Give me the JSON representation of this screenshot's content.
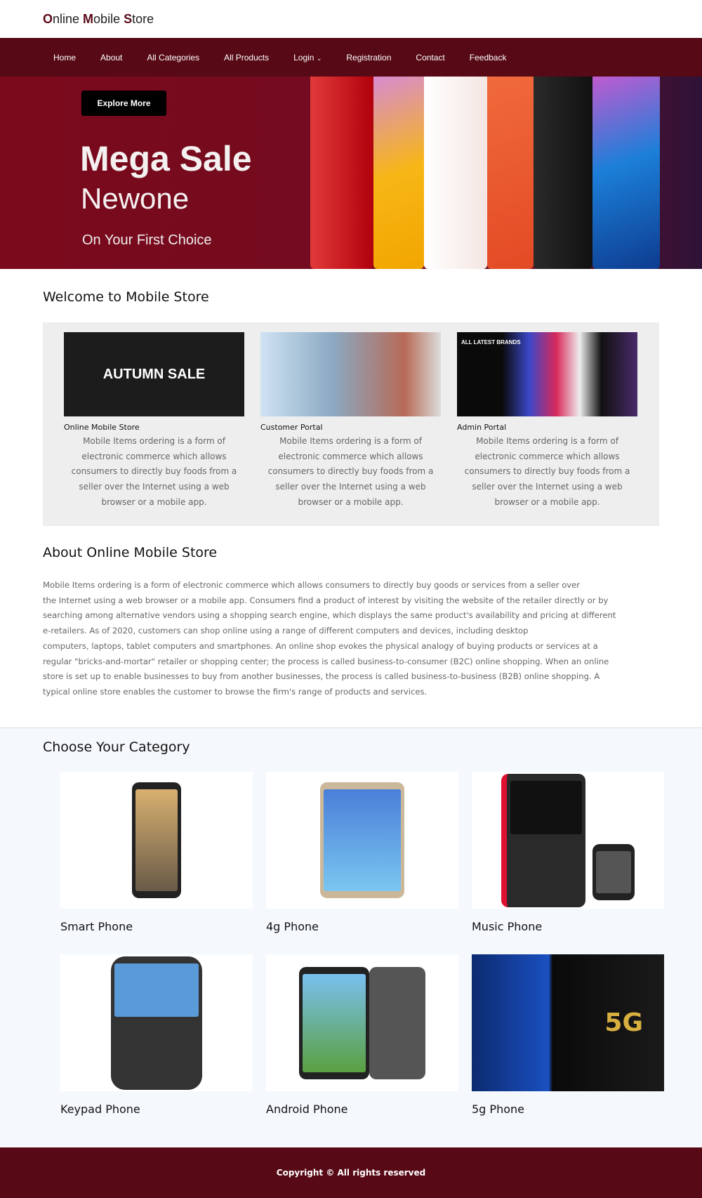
{
  "header": {
    "brand": [
      "O",
      "nline ",
      "M",
      "obile ",
      "S",
      "tore"
    ]
  },
  "nav": [
    "Home",
    "About",
    "All Categories",
    "All Products",
    "Login",
    "Registration",
    "Contact",
    "Feedback"
  ],
  "hero": {
    "button": "Explore More",
    "title": "Mega Sale",
    "subtitle": "Newone",
    "tagline": "On Your First Choice"
  },
  "welcome": {
    "title": "Welcome to Mobile Store",
    "cards": [
      {
        "title": "Online Mobile Store",
        "text": "Mobile Items ordering is a form of electronic commerce which allows consumers to directly buy foods from a seller over the Internet using a web browser or a mobile app.",
        "image_text": "AUTUMN SALE"
      },
      {
        "title": "Customer Portal",
        "text": "Mobile Items ordering is a form of electronic commerce which allows consumers to directly buy foods from a seller over the Internet using a web browser or a mobile app."
      },
      {
        "title": "Admin Portal",
        "text": "Mobile Items ordering is a form of electronic commerce which allows consumers to directly buy foods from a seller over the Internet using a web browser or a mobile app.",
        "image_text": "ALL LATEST BRANDS"
      }
    ]
  },
  "about": {
    "title": "About Online Mobile Store",
    "lines": [
      "Mobile Items ordering is a form of electronic commerce which allows consumers to directly buy goods or services from a seller over",
      "the Internet using a web browser or a mobile app. Consumers find a product of interest by visiting the website of the retailer directly or by",
      "searching among alternative vendors using a shopping search engine, which displays the same product's availability and pricing at different",
      "e-retailers. As of 2020, customers can shop online using a range of different computers and devices, including desktop",
      "computers, laptops, tablet computers and smartphones. An online shop evokes the physical analogy of buying products or services at a",
      "regular \"bricks-and-mortar\" retailer or shopping center; the process is called business-to-consumer (B2C) online shopping. When an online",
      "store is set up to enable businesses to buy from another businesses, the process is called business-to-business (B2B) online shopping. A",
      "typical online store enables the customer to browse the firm's range of products and services."
    ]
  },
  "categories": {
    "title": "Choose Your Category",
    "items": [
      "Smart Phone",
      "4g Phone",
      "Music Phone",
      "Keypad Phone",
      "Android Phone",
      "5g Phone"
    ]
  },
  "footer": {
    "copyright": "Copyright © All rights reserved"
  }
}
